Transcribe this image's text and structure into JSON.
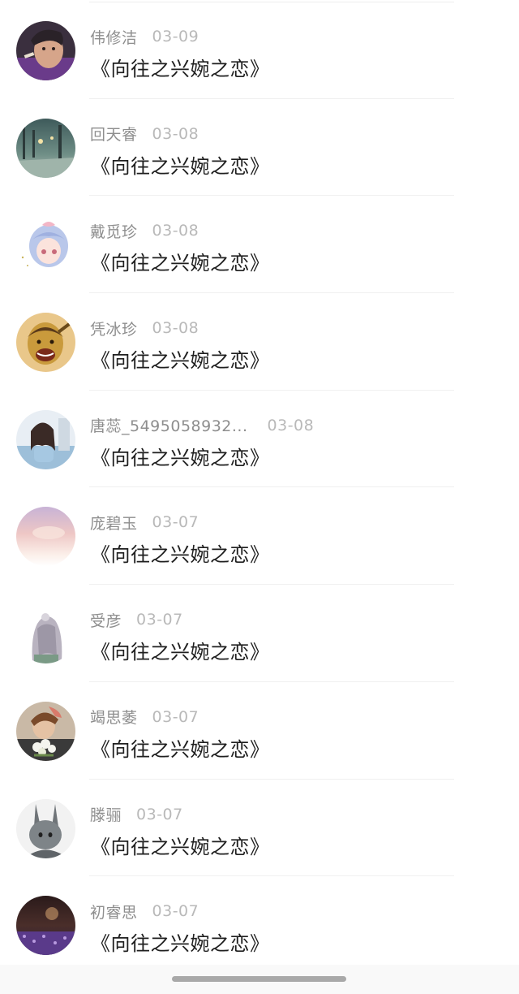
{
  "comments": [
    {
      "name": "伟修洁",
      "date": "03-09",
      "title": "《向往之兴婉之恋》",
      "avatar": "avatar-man-smoking"
    },
    {
      "name": "回天睿",
      "date": "03-08",
      "title": "《向往之兴婉之恋》",
      "avatar": "avatar-rainy-street"
    },
    {
      "name": "戴觅珍",
      "date": "03-08",
      "title": "《向往之兴婉之恋》",
      "avatar": "avatar-anime-girl"
    },
    {
      "name": "凭冰珍",
      "date": "03-08",
      "title": "《向往之兴婉之恋》",
      "avatar": "avatar-cartoon-laughing-man"
    },
    {
      "name": "唐蕊_5495058932...",
      "date": "03-08",
      "title": "《向往之兴婉之恋》",
      "avatar": "avatar-girl-portrait"
    },
    {
      "name": "庞碧玉",
      "date": "03-07",
      "title": "《向往之兴婉之恋》",
      "avatar": "avatar-pastel-sky"
    },
    {
      "name": "受彦",
      "date": "03-07",
      "title": "《向往之兴婉之恋》",
      "avatar": "avatar-illustrated-girl-back"
    },
    {
      "name": "竭思萎",
      "date": "03-07",
      "title": "《向往之兴婉之恋》",
      "avatar": "avatar-girl-flowers"
    },
    {
      "name": "滕骊",
      "date": "03-07",
      "title": "《向往之兴婉之恋》",
      "avatar": "avatar-rabbit-drawing"
    },
    {
      "name": "初睿思",
      "date": "03-07",
      "title": "《向往之兴婉之恋》",
      "avatar": "avatar-purple-field"
    }
  ],
  "colors": {
    "name": "#8e8e8e",
    "date": "#b9b9b9",
    "title": "#1f1f1f",
    "divider": "#f0f0f0",
    "home_indicator": "#a9a9a9"
  }
}
